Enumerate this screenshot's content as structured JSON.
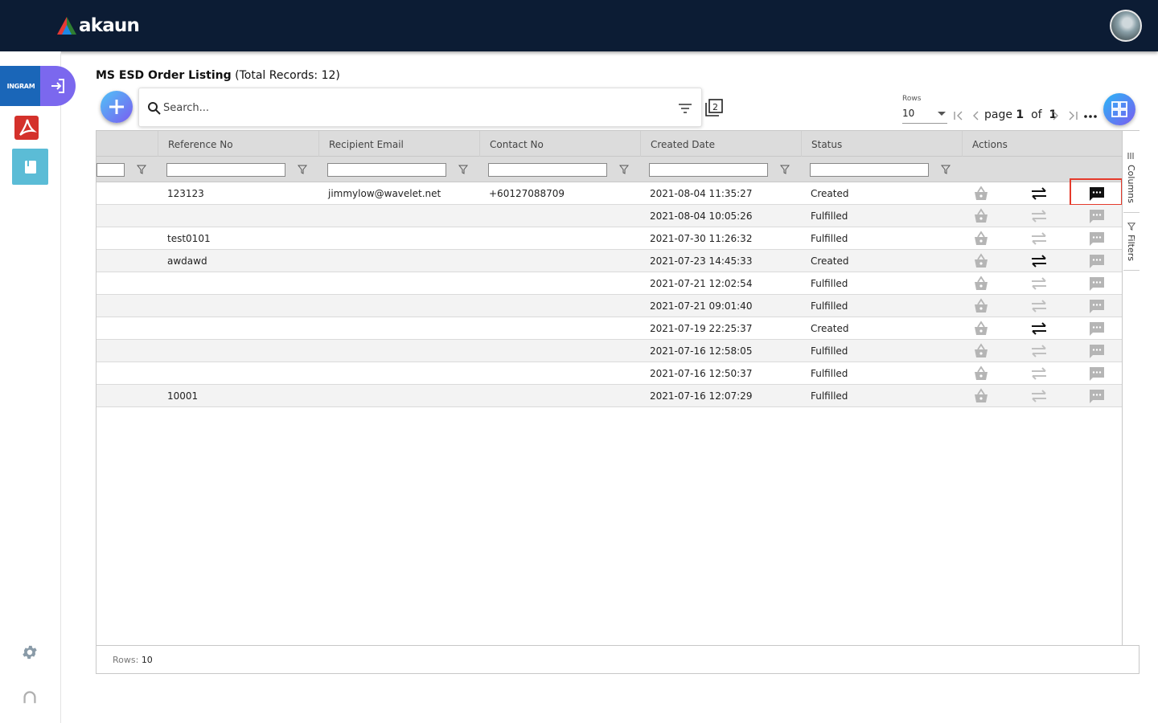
{
  "app": {
    "logo_text": "akaun",
    "brand_colors": {
      "topbar": "#0c1c34",
      "accent": "#7b5cf0",
      "highlight": "#e53a2b"
    }
  },
  "sidebar": {
    "ingram_label": "INGRAM",
    "items": [
      {
        "name": "login-icon"
      },
      {
        "name": "pdf-icon"
      },
      {
        "name": "book-icon"
      },
      {
        "name": "gear-icon"
      },
      {
        "name": "user-icon"
      }
    ]
  },
  "listing": {
    "title": "MS ESD Order Listing",
    "total_label": "(Total Records: 12)",
    "search_placeholder": "Search..."
  },
  "pager": {
    "rows_label": "Rows",
    "rows_value": "10",
    "page_word": "page",
    "page_current": "1",
    "of_word": "of",
    "page_total": "1"
  },
  "table": {
    "columns": [
      "Reference No",
      "Recipient Email",
      "Contact No",
      "Created Date",
      "Status",
      "Actions"
    ],
    "rows": [
      {
        "ref": "123123",
        "email": "jimmylow@wavelet.net",
        "contact": "+60127088709",
        "date": "2021-08-04 11:35:27",
        "status": "Created"
      },
      {
        "ref": "",
        "email": "",
        "contact": "",
        "date": "2021-08-04 10:05:26",
        "status": "Fulfilled"
      },
      {
        "ref": "test0101",
        "email": "",
        "contact": "",
        "date": "2021-07-30 11:26:32",
        "status": "Fulfilled"
      },
      {
        "ref": "awdawd",
        "email": "",
        "contact": "",
        "date": "2021-07-23 14:45:33",
        "status": "Created"
      },
      {
        "ref": "",
        "email": "",
        "contact": "",
        "date": "2021-07-21 12:02:54",
        "status": "Fulfilled"
      },
      {
        "ref": "",
        "email": "",
        "contact": "",
        "date": "2021-07-21 09:01:40",
        "status": "Fulfilled"
      },
      {
        "ref": "",
        "email": "",
        "contact": "",
        "date": "2021-07-19 22:25:37",
        "status": "Created"
      },
      {
        "ref": "",
        "email": "",
        "contact": "",
        "date": "2021-07-16 12:58:05",
        "status": "Fulfilled"
      },
      {
        "ref": "",
        "email": "",
        "contact": "",
        "date": "2021-07-16 12:50:37",
        "status": "Fulfilled"
      },
      {
        "ref": "10001",
        "email": "",
        "contact": "",
        "date": "2021-07-16 12:07:29",
        "status": "Fulfilled"
      }
    ],
    "action_icons": [
      "basket-icon",
      "transfer-icon",
      "comment-icon"
    ]
  },
  "side_tabs": {
    "columns": "Columns",
    "filters": "Filters"
  },
  "status_bar": {
    "rows_label": "Rows:",
    "rows_value": "10"
  }
}
